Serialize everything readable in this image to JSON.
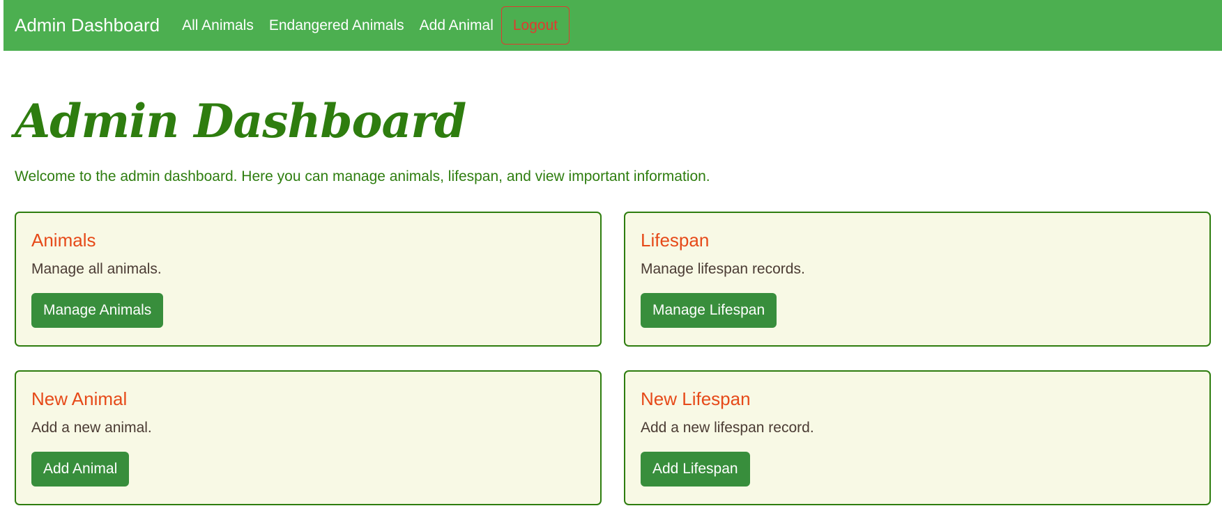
{
  "navbar": {
    "brand": "Admin Dashboard",
    "links": [
      {
        "label": "All Animals"
      },
      {
        "label": "Endangered Animals"
      },
      {
        "label": "Add Animal"
      }
    ],
    "logout_label": "Logout"
  },
  "main": {
    "title": "Admin Dashboard",
    "intro": "Welcome to the admin dashboard. Here you can manage animals, lifespan, and view important information.",
    "cards": [
      {
        "title": "Animals",
        "text": "Manage all animals.",
        "button": "Manage Animals"
      },
      {
        "title": "Lifespan",
        "text": "Manage lifespan records.",
        "button": "Manage Lifespan"
      },
      {
        "title": "New Animal",
        "text": "Add a new animal.",
        "button": "Add Animal"
      },
      {
        "title": "New Lifespan",
        "text": "Add a new lifespan record.",
        "button": "Add Lifespan"
      }
    ]
  },
  "colors": {
    "navbar": "#4caf50",
    "title": "#2e7d0f",
    "card_title": "#e64a19",
    "card_bg": "#f8f9e5",
    "button": "#388e3c",
    "logout": "#e03a2f"
  }
}
